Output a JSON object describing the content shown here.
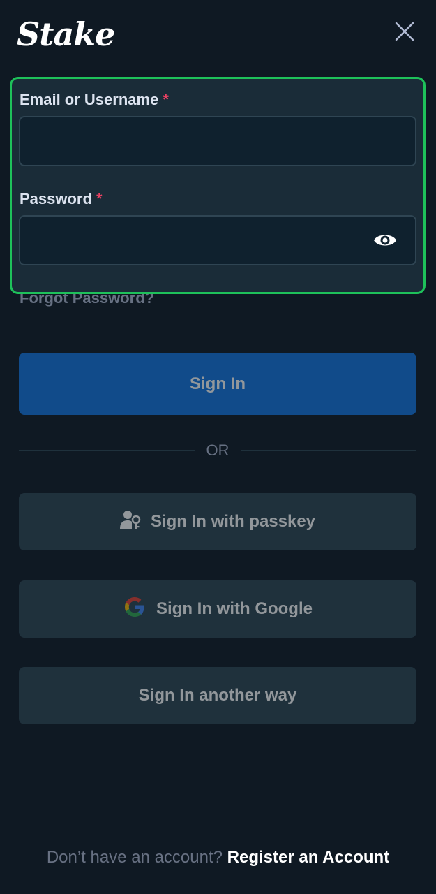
{
  "header": {
    "logo": "Stake"
  },
  "form": {
    "email_label": "Email or Username",
    "password_label": "Password",
    "required_mark": "*",
    "email_value": "",
    "password_value": ""
  },
  "forgot_password": "Forgot Password?",
  "buttons": {
    "sign_in": "Sign In",
    "or": "OR",
    "passkey": "Sign In with passkey",
    "google": "Sign In with Google",
    "another": "Sign In another way"
  },
  "footer": {
    "prompt": "Don’t have an account?",
    "register": "Register an Account"
  },
  "colors": {
    "background": "#0f1923",
    "primary_button": "#1475e1",
    "highlight_border": "#1ec15a",
    "required": "#ed4163"
  },
  "icons": [
    "close-icon",
    "eye-icon",
    "passkey-icon",
    "google-icon"
  ]
}
